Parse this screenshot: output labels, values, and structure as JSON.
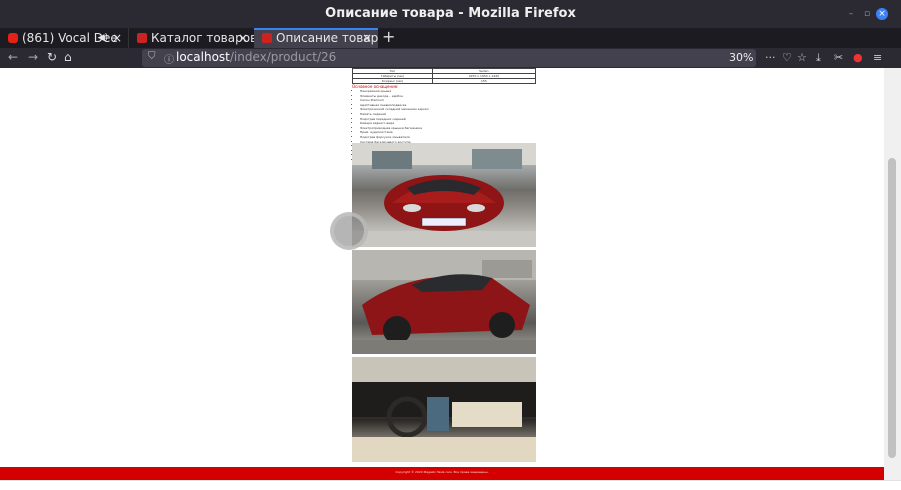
{
  "window": {
    "title": "Описание товара - Mozilla Firefox"
  },
  "tabs": [
    {
      "label": "(861) Vocal Dee",
      "close": "×"
    },
    {
      "label": "Каталог товаров",
      "close": "×"
    },
    {
      "label": "Описание товара",
      "close": "×"
    }
  ],
  "newtab": "+",
  "url": {
    "host": "localhost",
    "path": "/index/product/26"
  },
  "zoom": "30%",
  "spec_table": [
    [
      "Тип",
      "Sedan"
    ],
    [
      "Габариты (мм)",
      "4970 x 1950 x 1445"
    ],
    [
      "Клиренс (мм)",
      "155"
    ]
  ],
  "equipment_title": "Основное оснащение:",
  "equipment": [
    "Панорамная крыша",
    "Элементы декора – карбон",
    "Салон Premium",
    "Адаптивная пневмоподвеска",
    "Электрический складной механизм зеркал",
    "Память сидений",
    "Подогрев передних сидений",
    "Камера заднего вида",
    "Электроприводная крышка багажника",
    "Прем. аудиосистема",
    "Подогрев форсунок омывателя",
    "Система бесключевого доступа",
    "Система Autopilot",
    "Навигация",
    "Поддержка LTE",
    "Климат-контроль"
  ],
  "photos": [
    "front-view",
    "rear-view",
    "interior-view"
  ],
  "footer": "Copyright © 2024 Magazin Tesla cars. Все права защищены.",
  "colors": {
    "accent": "#d40000",
    "car": "#9b1b1b"
  }
}
